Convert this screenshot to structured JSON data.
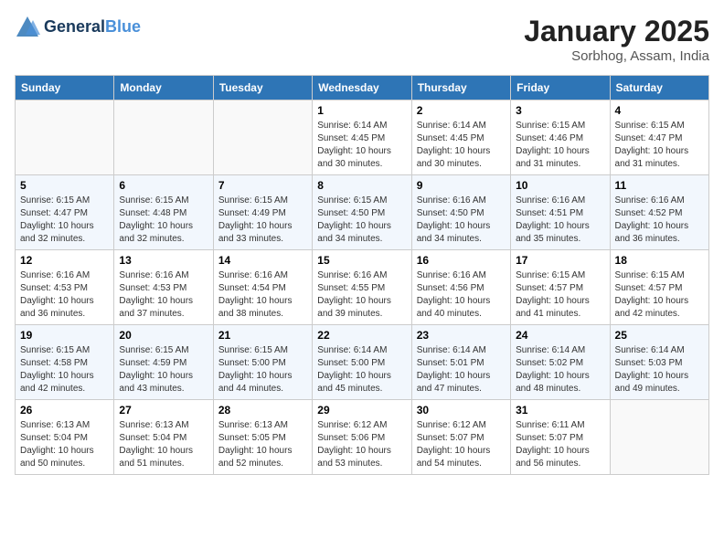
{
  "header": {
    "logo_line1": "General",
    "logo_line2": "Blue",
    "month": "January 2025",
    "location": "Sorbhog, Assam, India"
  },
  "days_of_week": [
    "Sunday",
    "Monday",
    "Tuesday",
    "Wednesday",
    "Thursday",
    "Friday",
    "Saturday"
  ],
  "weeks": [
    [
      {
        "day": "",
        "info": ""
      },
      {
        "day": "",
        "info": ""
      },
      {
        "day": "",
        "info": ""
      },
      {
        "day": "1",
        "info": "Sunrise: 6:14 AM\nSunset: 4:45 PM\nDaylight: 10 hours\nand 30 minutes."
      },
      {
        "day": "2",
        "info": "Sunrise: 6:14 AM\nSunset: 4:45 PM\nDaylight: 10 hours\nand 30 minutes."
      },
      {
        "day": "3",
        "info": "Sunrise: 6:15 AM\nSunset: 4:46 PM\nDaylight: 10 hours\nand 31 minutes."
      },
      {
        "day": "4",
        "info": "Sunrise: 6:15 AM\nSunset: 4:47 PM\nDaylight: 10 hours\nand 31 minutes."
      }
    ],
    [
      {
        "day": "5",
        "info": "Sunrise: 6:15 AM\nSunset: 4:47 PM\nDaylight: 10 hours\nand 32 minutes."
      },
      {
        "day": "6",
        "info": "Sunrise: 6:15 AM\nSunset: 4:48 PM\nDaylight: 10 hours\nand 32 minutes."
      },
      {
        "day": "7",
        "info": "Sunrise: 6:15 AM\nSunset: 4:49 PM\nDaylight: 10 hours\nand 33 minutes."
      },
      {
        "day": "8",
        "info": "Sunrise: 6:15 AM\nSunset: 4:50 PM\nDaylight: 10 hours\nand 34 minutes."
      },
      {
        "day": "9",
        "info": "Sunrise: 6:16 AM\nSunset: 4:50 PM\nDaylight: 10 hours\nand 34 minutes."
      },
      {
        "day": "10",
        "info": "Sunrise: 6:16 AM\nSunset: 4:51 PM\nDaylight: 10 hours\nand 35 minutes."
      },
      {
        "day": "11",
        "info": "Sunrise: 6:16 AM\nSunset: 4:52 PM\nDaylight: 10 hours\nand 36 minutes."
      }
    ],
    [
      {
        "day": "12",
        "info": "Sunrise: 6:16 AM\nSunset: 4:53 PM\nDaylight: 10 hours\nand 36 minutes."
      },
      {
        "day": "13",
        "info": "Sunrise: 6:16 AM\nSunset: 4:53 PM\nDaylight: 10 hours\nand 37 minutes."
      },
      {
        "day": "14",
        "info": "Sunrise: 6:16 AM\nSunset: 4:54 PM\nDaylight: 10 hours\nand 38 minutes."
      },
      {
        "day": "15",
        "info": "Sunrise: 6:16 AM\nSunset: 4:55 PM\nDaylight: 10 hours\nand 39 minutes."
      },
      {
        "day": "16",
        "info": "Sunrise: 6:16 AM\nSunset: 4:56 PM\nDaylight: 10 hours\nand 40 minutes."
      },
      {
        "day": "17",
        "info": "Sunrise: 6:15 AM\nSunset: 4:57 PM\nDaylight: 10 hours\nand 41 minutes."
      },
      {
        "day": "18",
        "info": "Sunrise: 6:15 AM\nSunset: 4:57 PM\nDaylight: 10 hours\nand 42 minutes."
      }
    ],
    [
      {
        "day": "19",
        "info": "Sunrise: 6:15 AM\nSunset: 4:58 PM\nDaylight: 10 hours\nand 42 minutes."
      },
      {
        "day": "20",
        "info": "Sunrise: 6:15 AM\nSunset: 4:59 PM\nDaylight: 10 hours\nand 43 minutes."
      },
      {
        "day": "21",
        "info": "Sunrise: 6:15 AM\nSunset: 5:00 PM\nDaylight: 10 hours\nand 44 minutes."
      },
      {
        "day": "22",
        "info": "Sunrise: 6:14 AM\nSunset: 5:00 PM\nDaylight: 10 hours\nand 45 minutes."
      },
      {
        "day": "23",
        "info": "Sunrise: 6:14 AM\nSunset: 5:01 PM\nDaylight: 10 hours\nand 47 minutes."
      },
      {
        "day": "24",
        "info": "Sunrise: 6:14 AM\nSunset: 5:02 PM\nDaylight: 10 hours\nand 48 minutes."
      },
      {
        "day": "25",
        "info": "Sunrise: 6:14 AM\nSunset: 5:03 PM\nDaylight: 10 hours\nand 49 minutes."
      }
    ],
    [
      {
        "day": "26",
        "info": "Sunrise: 6:13 AM\nSunset: 5:04 PM\nDaylight: 10 hours\nand 50 minutes."
      },
      {
        "day": "27",
        "info": "Sunrise: 6:13 AM\nSunset: 5:04 PM\nDaylight: 10 hours\nand 51 minutes."
      },
      {
        "day": "28",
        "info": "Sunrise: 6:13 AM\nSunset: 5:05 PM\nDaylight: 10 hours\nand 52 minutes."
      },
      {
        "day": "29",
        "info": "Sunrise: 6:12 AM\nSunset: 5:06 PM\nDaylight: 10 hours\nand 53 minutes."
      },
      {
        "day": "30",
        "info": "Sunrise: 6:12 AM\nSunset: 5:07 PM\nDaylight: 10 hours\nand 54 minutes."
      },
      {
        "day": "31",
        "info": "Sunrise: 6:11 AM\nSunset: 5:07 PM\nDaylight: 10 hours\nand 56 minutes."
      },
      {
        "day": "",
        "info": ""
      }
    ]
  ]
}
